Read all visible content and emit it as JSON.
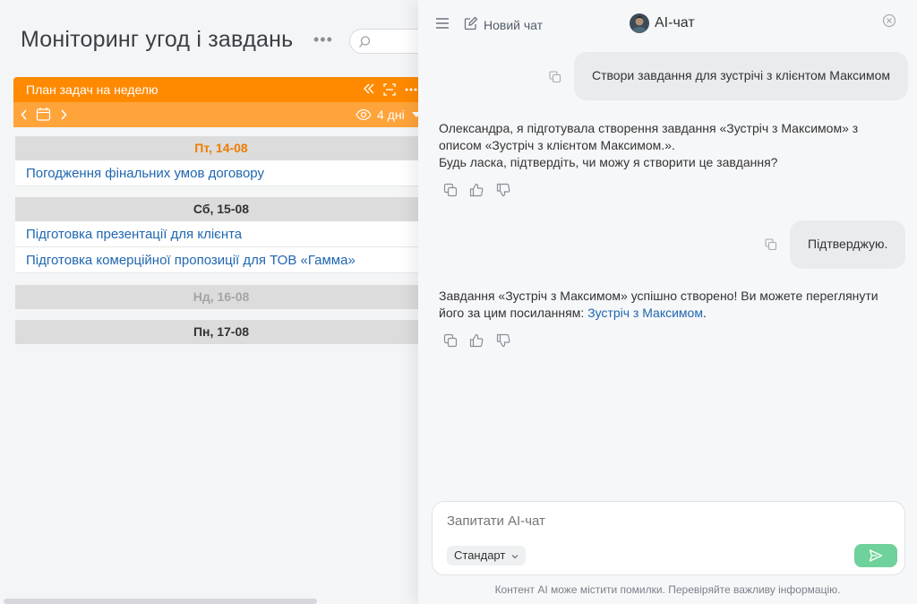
{
  "page": {
    "title": "Моніторинг угод і завдань",
    "more": "•••"
  },
  "widget": {
    "title": "План задач на неделю",
    "days_label": "4 дні",
    "accent": "#ff8a00",
    "days": [
      {
        "header": "Пт, 14-08",
        "state": "today",
        "tasks": [
          "Погодження фінальних умов договору"
        ]
      },
      {
        "header": "Сб, 15-08",
        "state": "normal",
        "tasks": [
          "Підготовка презентації для клієнта",
          "Підготовка комерційної пропозиції для ТОВ «Гамма»"
        ]
      },
      {
        "header": "Нд, 16-08",
        "state": "weekend",
        "tasks": []
      },
      {
        "header": "Пн, 17-08",
        "state": "normal",
        "tasks": []
      }
    ]
  },
  "chat": {
    "new_chat_label": "Новий чат",
    "title": "AI-чат",
    "messages": [
      {
        "role": "user",
        "text": "Створи завдання для зустрічі з клієнтом Максимом"
      },
      {
        "role": "ai",
        "lines": [
          "Олександра, я підготувала створення завдання «Зустріч з Максимом» з",
          "описом «Зустріч з клієнтом Максимом.».",
          "Будь ласка, підтвердіть, чи можу я створити це завдання?"
        ]
      },
      {
        "role": "user",
        "text": "Підтверджую."
      },
      {
        "role": "ai",
        "line1": "Завдання «Зустріч з Максимом» успішно створено! Ви можете переглянути",
        "line2_prefix": "його за цим посиланням: ",
        "link": "Зустріч з Максимом",
        "line2_suffix": "."
      }
    ],
    "input_placeholder": "Запитати AI-чат",
    "mode_label": "Стандарт",
    "disclaimer": "Контент AI може містити помилки. Перевіряйте важливу інформацію.",
    "send_color": "#6fd19b"
  }
}
